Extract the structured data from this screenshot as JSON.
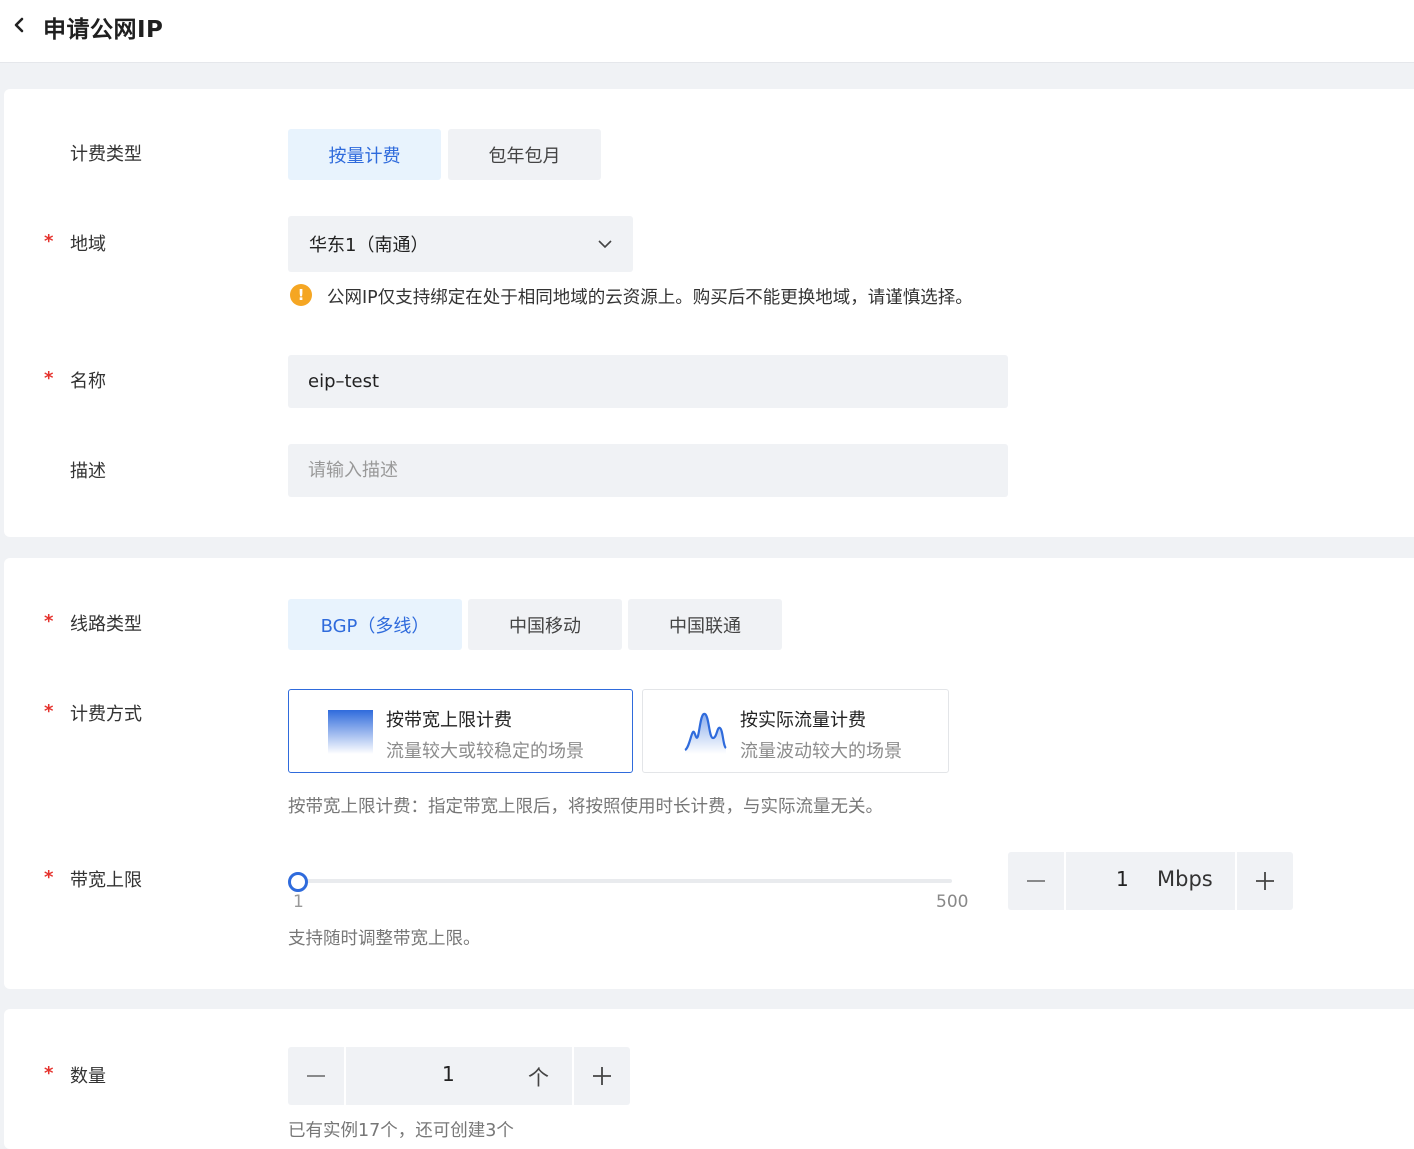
{
  "header": {
    "title": "申请公网IP"
  },
  "basic": {
    "billing_type": {
      "label": "计费类型",
      "options": [
        "按量计费",
        "包年包月"
      ],
      "selected": "按量计费"
    },
    "region": {
      "required_mark": "*",
      "label": "地域",
      "value": "华东1（南通）",
      "warning": "公网IP仅支持绑定在处于相同地域的云资源上。购买后不能更换地域，请谨慎选择。"
    },
    "name": {
      "required_mark": "*",
      "label": "名称",
      "value": "eip–test"
    },
    "description": {
      "label": "描述",
      "placeholder": "请输入描述"
    }
  },
  "network": {
    "line_type": {
      "required_mark": "*",
      "label": "线路类型",
      "options": [
        "BGP（多线）",
        "中国移动",
        "中国联通"
      ],
      "selected": "BGP（多线）"
    },
    "billing_method": {
      "required_mark": "*",
      "label": "计费方式",
      "options": [
        {
          "title": "按带宽上限计费",
          "desc": "流量较大或较稳定的场景",
          "icon": "bandwidth-gradient-icon"
        },
        {
          "title": "按实际流量计费",
          "desc": "流量波动较大的场景",
          "icon": "traffic-wave-icon"
        }
      ],
      "selected": "按带宽上限计费",
      "hint": "按带宽上限计费：指定带宽上限后，将按照使用时长计费，与实际流量无关。"
    },
    "bandwidth": {
      "required_mark": "*",
      "label": "带宽上限",
      "min": "1",
      "max": "500",
      "value": "1",
      "unit": "Mbps",
      "hint": "支持随时调整带宽上限。"
    }
  },
  "quantity": {
    "required_mark": "*",
    "label": "数量",
    "value": "1",
    "unit": "个",
    "hint": "已有实例17个，还可创建3个"
  },
  "colors": {
    "accent": "#2f6bdc",
    "required": "#e5322d",
    "warning": "#f5a623"
  }
}
